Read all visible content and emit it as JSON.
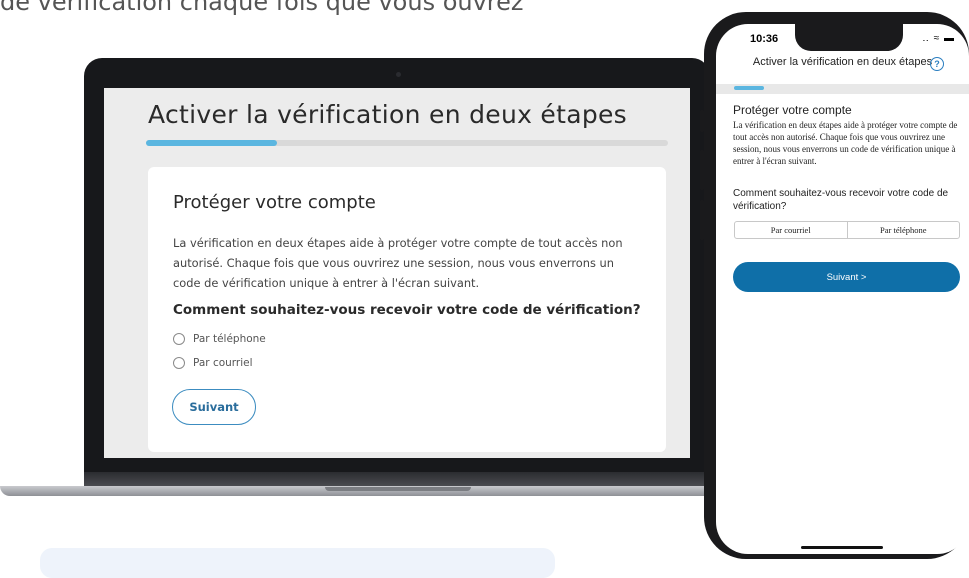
{
  "page": {
    "top_caption": "de vérification chaque fois que vous ouvrez"
  },
  "laptop": {
    "title": "Activer la vérification en deux étapes",
    "progress_percent": 25,
    "card": {
      "title": "Protéger votre compte",
      "description": "La vérification en deux étapes aide à protéger votre compte de tout accès non autorisé. Chaque fois que vous ouvrirez une session, nous vous enverrons un code de vérification unique à entrer à l'écran suivant.",
      "question": "Comment souhaitez-vous recevoir votre code de vérification?",
      "options": [
        "Par téléphone",
        "Par courriel"
      ],
      "button_label": "Suivant"
    }
  },
  "phone": {
    "status": {
      "time": "10:36",
      "icons": "‥ ≈ ▬"
    },
    "header_title": "Activer la vérification en deux étapes",
    "help_icon": "?",
    "progress_percent": 20,
    "title": "Protéger votre compte",
    "description": "La vérification en deux étapes aide à protéger votre compte de tout accès non autorisé. Chaque fois que vous ouvrirez une session, nous vous enverrons un code de vérification unique à entrer à l'écran suivant.",
    "question": "Comment souhaitez-vous recevoir votre code de vérification?",
    "segments": [
      "Par courriel",
      "Par téléphone"
    ],
    "next_label": "Suivant >"
  },
  "colors": {
    "progress": "#5bb6e0",
    "primary_button": "#0f6fa8",
    "outline_button": "#3c8cc0"
  }
}
